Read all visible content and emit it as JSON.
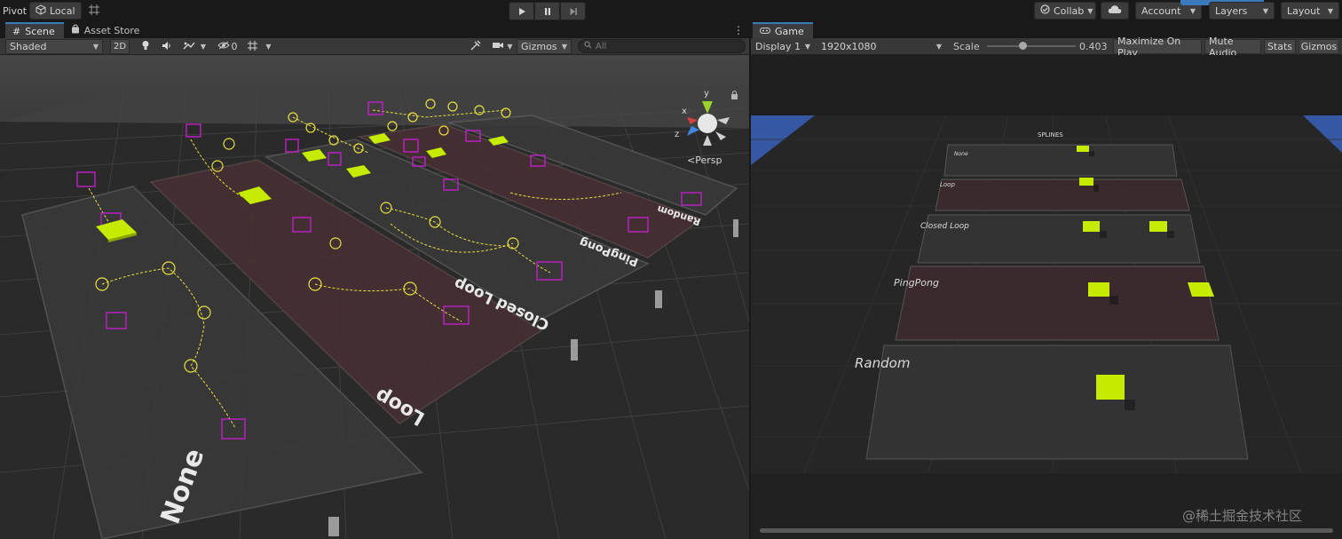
{
  "toolbar": {
    "pivot_label": "Pivot",
    "local_label": "Local",
    "collab_label": "Collab",
    "account_label": "Account",
    "layers_label": "Layers",
    "layout_label": "Layout",
    "icons": [
      "play-icon",
      "pause-icon",
      "step-icon",
      "cloud-icon",
      "grid-snap-icon"
    ]
  },
  "scene": {
    "tabs": [
      {
        "label": "Scene",
        "icon": "hash-icon"
      },
      {
        "label": "Asset Store",
        "icon": "bag-icon"
      }
    ],
    "shading": "Shaded",
    "two_d": "2D",
    "hidden_count": "0",
    "gizmos": "Gizmos",
    "search_placeholder": "All",
    "persp_label": "<Persp",
    "axis": {
      "y": "y",
      "x": "x",
      "z": "z"
    },
    "lane_labels": {
      "none": "None",
      "loop": "Loop",
      "closed_loop": "Closed Loop",
      "pingpong": "PingPong",
      "random": "Random"
    }
  },
  "game": {
    "tab": "Game",
    "display": "Display 1",
    "resolution": "1920x1080",
    "scale_label": "Scale",
    "scale_value": 0.403,
    "scale_text": "0.403",
    "maximize": "Maximize On Play",
    "mute": "Mute Audio",
    "stats": "Stats",
    "gizmos": "Gizmos",
    "title": "SPLINES",
    "lanes": [
      "None",
      "Loop",
      "Closed Loop",
      "PingPong",
      "Random"
    ]
  },
  "watermark": "@稀土掘金技术社区",
  "colors": {
    "accent": "#3a79bb",
    "lime": "#c6ea00",
    "magenta": "#c020c8",
    "gizmo_yellow": "#e8e040"
  }
}
